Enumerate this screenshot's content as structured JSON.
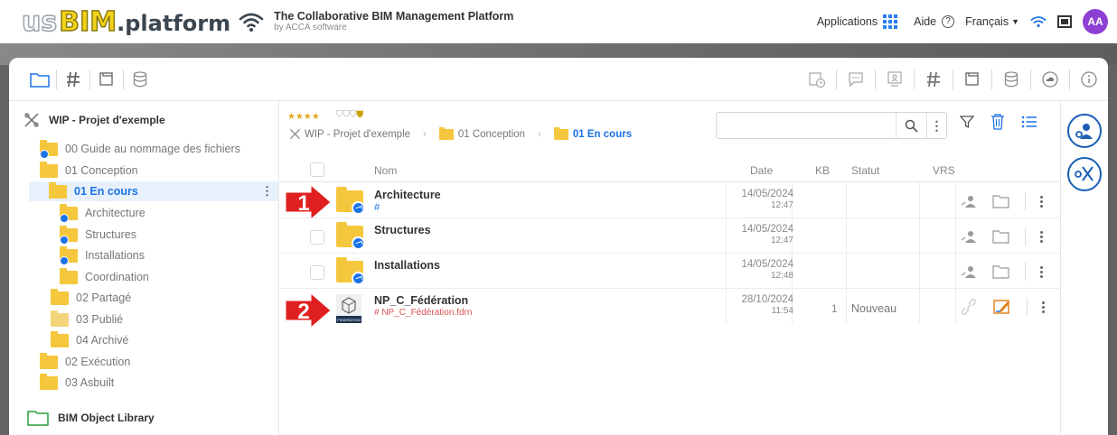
{
  "header": {
    "logo": {
      "us": "us",
      "bim": "BIM",
      "platform": ".platform"
    },
    "tagline": "The Collaborative BIM Management Platform",
    "byline": "by ACCA software",
    "applications_label": "Applications",
    "help_label": "Aide",
    "language_label": "Français",
    "avatar_initials": "AA"
  },
  "tree": {
    "root_label": "WIP - Projet d'exemple",
    "items": [
      {
        "label": "00 Guide au nommage des fichiers",
        "shared": true,
        "selected": false
      },
      {
        "label": "01 Conception",
        "shared": false,
        "selected": false
      },
      {
        "label": "01 En cours",
        "shared": false,
        "selected": true
      },
      {
        "label": "Architecture",
        "shared": true,
        "selected": false
      },
      {
        "label": "Structures",
        "shared": true,
        "selected": false
      },
      {
        "label": "Installations",
        "shared": true,
        "selected": false
      },
      {
        "label": "Coordination",
        "shared": false,
        "selected": false
      },
      {
        "label": "02 Partagé",
        "shared": false,
        "selected": false
      },
      {
        "label": "03 Publié",
        "shared": false,
        "selected": false
      },
      {
        "label": "04 Archivé",
        "shared": false,
        "selected": false
      },
      {
        "label": "02 Exécution",
        "shared": false,
        "selected": false
      },
      {
        "label": "03 Asbuilt",
        "shared": false,
        "selected": false
      }
    ],
    "library_label": "BIM Object Library"
  },
  "pane": {
    "stars": "★★★★",
    "shields": "⛉⛉⛉",
    "breadcrumb": {
      "root": "WIP - Projet d'exemple",
      "level1": "01 Conception",
      "current": "01 En cours"
    },
    "search_placeholder": "",
    "columns": {
      "name": "Nom",
      "date": "Date",
      "kb": "KB",
      "status": "Statut",
      "vrs": "VRS"
    },
    "rows": [
      {
        "name": "Architecture",
        "sub": "#",
        "date": "14/05/2024",
        "time": "12:47",
        "kb": "",
        "status": ""
      },
      {
        "name": "Structures",
        "sub": "",
        "date": "14/05/2024",
        "time": "12:47",
        "kb": "",
        "status": ""
      },
      {
        "name": "Installations",
        "sub": "",
        "date": "14/05/2024",
        "time": "12:48",
        "kb": "",
        "status": ""
      },
      {
        "name": "NP_C_Fédération",
        "sub": "#  NP_C_Fédération.fdrn",
        "date": "28/10/2024",
        "time": "11:54",
        "kb": "1",
        "status": "Nouveau"
      }
    ],
    "fed_icon_caption": "FEDERATION",
    "markers": [
      "1",
      "2"
    ]
  },
  "colors": {
    "accent": "#1a73e8",
    "folder": "#f5c73d",
    "marker_red": "#e02020",
    "avatar": "#8d3fd3",
    "band": "#636363"
  },
  "icons": {
    "toolbar_left": [
      "folder-icon",
      "hash-icon",
      "model-icon",
      "database-icon"
    ],
    "toolbar_right": [
      "calendar-clock-icon",
      "chat-icon",
      "presentation-icon",
      "hash-icon",
      "model-icon",
      "database-icon",
      "cloud-icon",
      "info-icon"
    ],
    "side": [
      "users-settings-icon",
      "bim-tools-icon"
    ]
  }
}
